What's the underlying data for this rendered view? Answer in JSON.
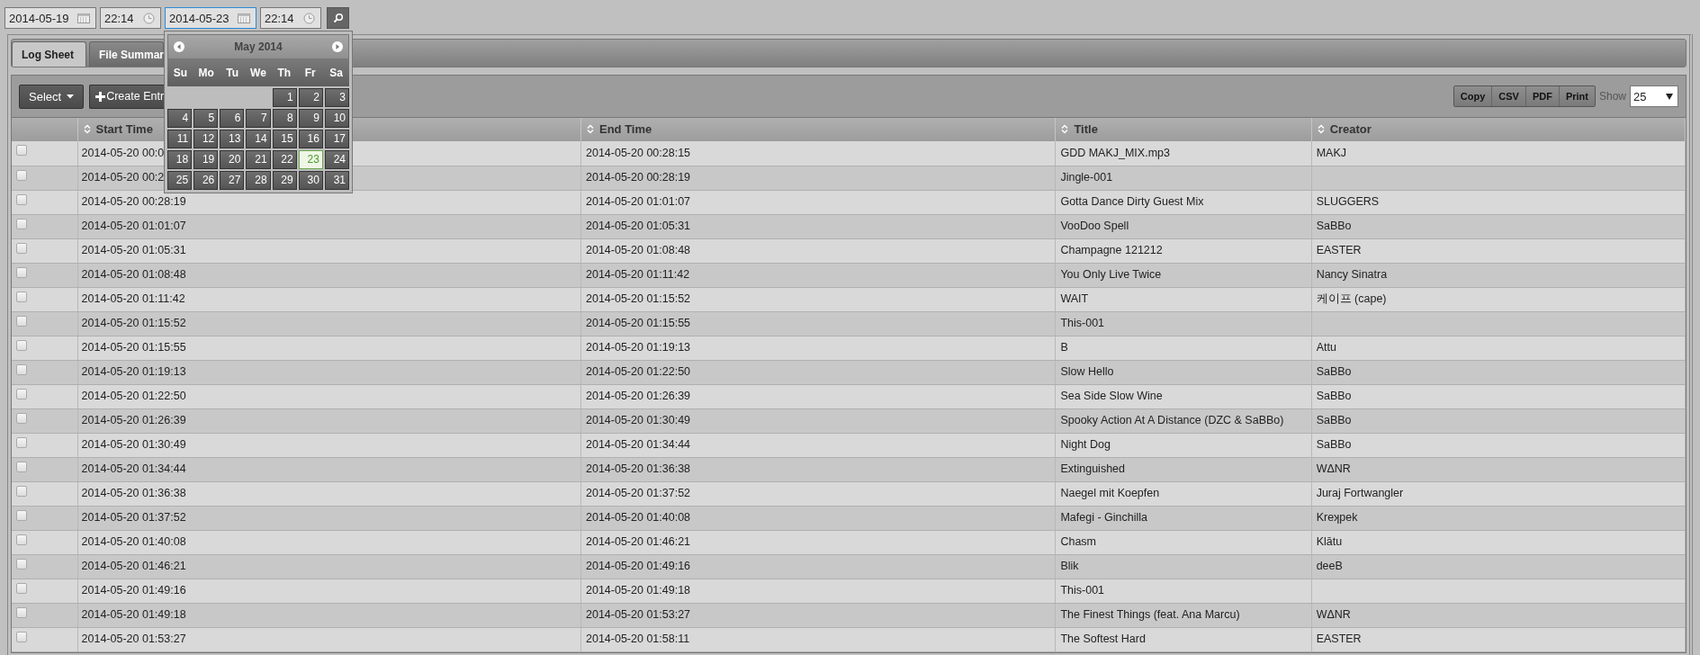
{
  "filters": [
    {
      "kind": "date",
      "value": "2014-05-19",
      "focused": false
    },
    {
      "kind": "time",
      "value": "22:14",
      "focused": false
    },
    {
      "kind": "date",
      "value": "2014-05-23",
      "focused": true
    },
    {
      "kind": "time",
      "value": "22:14",
      "focused": false
    }
  ],
  "tabs": [
    {
      "label": "Log Sheet",
      "selected": true
    },
    {
      "label": "File Summar",
      "selected": false
    }
  ],
  "toolbar": {
    "select_button": "Select",
    "create_button": "Create Entr",
    "export_buttons": [
      "Copy",
      "CSV",
      "PDF",
      "Print"
    ],
    "show_label": "Show",
    "page_size": "25"
  },
  "table": {
    "columns": [
      "",
      "Start Time",
      "End Time",
      "Title",
      "Creator"
    ],
    "rows": [
      {
        "checked": false,
        "start": "2014-05-20 00:0",
        "end": "2014-05-20 00:28:15",
        "title": "GDD MAKJ_MIX.mp3",
        "creator": "MAKJ"
      },
      {
        "checked": false,
        "start": "2014-05-20 00:2",
        "end": "2014-05-20 00:28:19",
        "title": "Jingle-001"
      },
      {
        "checked": false,
        "start": "2014-05-20 00:28:19",
        "end": "2014-05-20 01:01:07",
        "title": "Gotta Dance Dirty Guest Mix",
        "creator": "SLUGGERS"
      },
      {
        "checked": false,
        "start": "2014-05-20 01:01:07",
        "end": "2014-05-20 01:05:31",
        "title": "VooDoo Spell",
        "creator": "SaBBo"
      },
      {
        "checked": false,
        "start": "2014-05-20 01:05:31",
        "end": "2014-05-20 01:08:48",
        "title": "Champagne 121212",
        "creator": "EASTER"
      },
      {
        "checked": false,
        "start": "2014-05-20 01:08:48",
        "end": "2014-05-20 01:11:42",
        "title": "You Only Live Twice",
        "creator": "Nancy Sinatra"
      },
      {
        "checked": false,
        "start": "2014-05-20 01:11:42",
        "end": "2014-05-20 01:15:52",
        "title": "WAIT",
        "creator": "케이프 (cape)"
      },
      {
        "checked": false,
        "start": "2014-05-20 01:15:52",
        "end": "2014-05-20 01:15:55",
        "title": "This-001"
      },
      {
        "checked": false,
        "start": "2014-05-20 01:15:55",
        "end": "2014-05-20 01:19:13",
        "title": "B",
        "creator": "Attu"
      },
      {
        "checked": false,
        "start": "2014-05-20 01:19:13",
        "end": "2014-05-20 01:22:50",
        "title": "Slow Hello",
        "creator": "SaBBo"
      },
      {
        "checked": false,
        "start": "2014-05-20 01:22:50",
        "end": "2014-05-20 01:26:39",
        "title": "Sea Side Slow Wine",
        "creator": "SaBBo"
      },
      {
        "checked": false,
        "start": "2014-05-20 01:26:39",
        "end": "2014-05-20 01:30:49",
        "title": "Spooky Action At A Distance (DZC & SaBBo)",
        "creator": "SaBBo"
      },
      {
        "checked": false,
        "start": "2014-05-20 01:30:49",
        "end": "2014-05-20 01:34:44",
        "title": "Night Dog",
        "creator": "SaBBo"
      },
      {
        "checked": false,
        "start": "2014-05-20 01:34:44",
        "end": "2014-05-20 01:36:38",
        "title": "Extinguished",
        "creator": "WΔNR"
      },
      {
        "checked": false,
        "start": "2014-05-20 01:36:38",
        "end": "2014-05-20 01:37:52",
        "title": "Naegel mit Koepfen",
        "creator": "Juraj Fortwangler"
      },
      {
        "checked": false,
        "start": "2014-05-20 01:37:52",
        "end": "2014-05-20 01:40:08",
        "title": "Mafegi - Ginchilla",
        "creator": "Kreʞpek"
      },
      {
        "checked": false,
        "start": "2014-05-20 01:40:08",
        "end": "2014-05-20 01:46:21",
        "title": "Chasm",
        "creator": "Klātu"
      },
      {
        "checked": false,
        "start": "2014-05-20 01:46:21",
        "end": "2014-05-20 01:49:16",
        "title": "Blik",
        "creator": "deeB"
      },
      {
        "checked": false,
        "start": "2014-05-20 01:49:16",
        "end": "2014-05-20 01:49:18",
        "title": "This-001"
      },
      {
        "checked": false,
        "start": "2014-05-20 01:49:18",
        "end": "2014-05-20 01:53:27",
        "title": "The Finest Things (feat. Ana Marcu)",
        "creator": "WΔNR"
      },
      {
        "checked": false,
        "start": "2014-05-20 01:53:27",
        "end": "2014-05-20 01:58:11",
        "title": "The Softest Hard",
        "creator": "EASTER"
      }
    ]
  },
  "datepicker": {
    "month": "May 2014",
    "weekdays": [
      "Su",
      "Mo",
      "Tu",
      "We",
      "Th",
      "Fr",
      "Sa"
    ],
    "weeks": [
      [
        {
          "day": "1",
          "selected": false
        },
        {
          "day": "2",
          "selected": false
        },
        {
          "day": "3",
          "selected": false
        }
      ],
      [
        {
          "day": "4",
          "selected": false
        },
        {
          "day": "5",
          "selected": false
        },
        {
          "day": "6",
          "selected": false
        },
        {
          "day": "7",
          "selected": false
        },
        {
          "day": "8",
          "selected": false
        },
        {
          "day": "9",
          "selected": false
        },
        {
          "day": "10",
          "selected": false
        }
      ],
      [
        {
          "day": "11",
          "selected": false
        },
        {
          "day": "12",
          "selected": false
        },
        {
          "day": "13",
          "selected": false
        },
        {
          "day": "14",
          "selected": false
        },
        {
          "day": "15",
          "selected": false
        },
        {
          "day": "16",
          "selected": false
        },
        {
          "day": "17",
          "selected": false
        }
      ],
      [
        {
          "day": "18",
          "selected": false
        },
        {
          "day": "19",
          "selected": false
        },
        {
          "day": "20",
          "selected": false
        },
        {
          "day": "21",
          "selected": false
        },
        {
          "day": "22",
          "selected": false
        },
        {
          "day": "23",
          "selected": true
        },
        {
          "day": "24",
          "selected": false
        }
      ],
      [
        {
          "day": "25",
          "selected": false
        },
        {
          "day": "26",
          "selected": false
        },
        {
          "day": "27",
          "selected": false
        },
        {
          "day": "28",
          "selected": false
        },
        {
          "day": "29",
          "selected": false
        },
        {
          "day": "30",
          "selected": false
        },
        {
          "day": "31",
          "selected": false
        }
      ]
    ]
  }
}
